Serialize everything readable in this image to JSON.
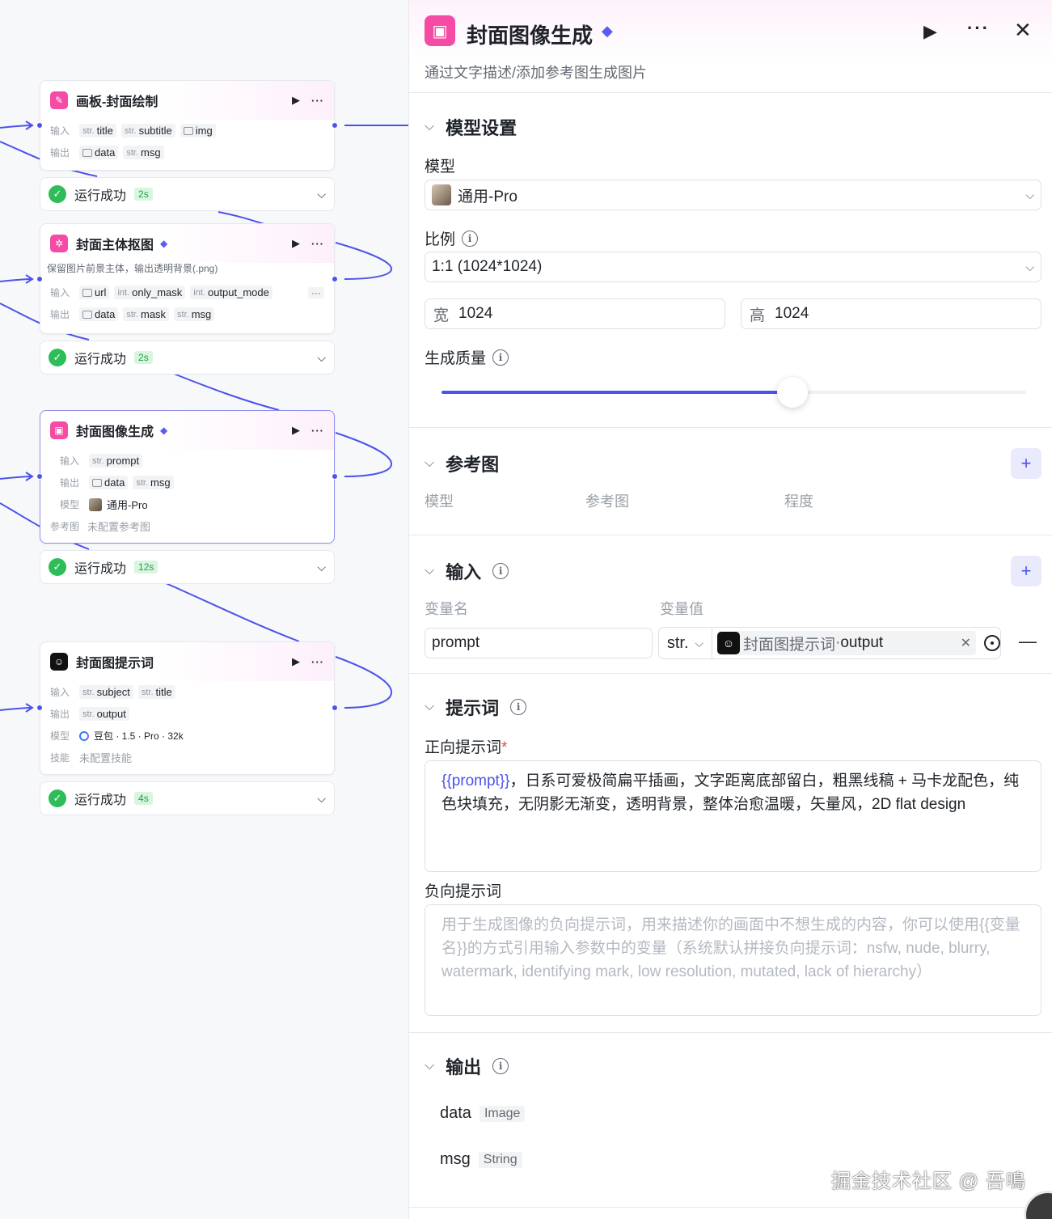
{
  "canvas": {
    "nodes": [
      {
        "id": "n1",
        "title": "画板-封面绘制",
        "has_premium": false,
        "icon": "pink-image-edit-icon",
        "inputs_label": "输入",
        "outputs_label": "输出",
        "inputs": [
          {
            "type": "str",
            "name": "title"
          },
          {
            "type": "str",
            "name": "subtitle"
          },
          {
            "type": "img",
            "name": "img"
          }
        ],
        "outputs": [
          {
            "type": "img",
            "name": "data"
          },
          {
            "type": "str",
            "name": "msg"
          }
        ],
        "status": "运行成功",
        "time": "2s"
      },
      {
        "id": "n2",
        "title": "封面主体抠图",
        "has_premium": true,
        "icon": "pink-cutout-icon",
        "description": "保留图片前景主体，输出透明背景(.png)",
        "inputs_label": "输入",
        "outputs_label": "输出",
        "inputs": [
          {
            "type": "img",
            "name": "url"
          },
          {
            "type": "int",
            "name": "only_mask"
          },
          {
            "type": "int",
            "name": "output_mode"
          }
        ],
        "inputs_more": "···",
        "outputs": [
          {
            "type": "img",
            "name": "data"
          },
          {
            "type": "str",
            "name": "mask"
          },
          {
            "type": "str",
            "name": "msg"
          }
        ],
        "status": "运行成功",
        "time": "2s"
      },
      {
        "id": "n3",
        "title": "封面图像生成",
        "has_premium": true,
        "icon": "pink-image-gen-icon",
        "inputs_label": "输入",
        "outputs_label": "输出",
        "model_label": "模型",
        "model_value": "通用-Pro",
        "ref_label": "参考图",
        "ref_value": "未配置参考图",
        "inputs": [
          {
            "type": "str",
            "name": "prompt"
          }
        ],
        "outputs": [
          {
            "type": "img",
            "name": "data"
          },
          {
            "type": "str",
            "name": "msg"
          }
        ],
        "status": "运行成功",
        "time": "12s"
      },
      {
        "id": "n4",
        "title": "封面图提示词",
        "has_premium": false,
        "icon": "black-llm-icon",
        "inputs_label": "输入",
        "outputs_label": "输出",
        "model_label": "模型",
        "model_value": "豆包 · 1.5 · Pro · 32k",
        "skill_label": "技能",
        "skill_value": "未配置技能",
        "inputs": [
          {
            "type": "str",
            "name": "subject"
          },
          {
            "type": "str",
            "name": "title"
          }
        ],
        "outputs": [
          {
            "type": "str",
            "name": "output"
          }
        ],
        "status": "运行成功",
        "time": "4s"
      }
    ]
  },
  "panel": {
    "title": "封面图像生成",
    "subtitle": "通过文字描述/添加参考图生成图片",
    "model_section": {
      "title": "模型设置",
      "model_label": "模型",
      "model_value": "通用-Pro",
      "ratio_label": "比例",
      "ratio_value": "1:1 (1024*1024)",
      "width_label": "宽",
      "width_value": "1024",
      "height_label": "高",
      "height_value": "1024",
      "quality_label": "生成质量",
      "quality_fraction": 0.6
    },
    "ref_section": {
      "title": "参考图",
      "col_model": "模型",
      "col_ref": "参考图",
      "col_degree": "程度"
    },
    "input_section": {
      "title": "输入",
      "col_name": "变量名",
      "col_value": "变量值",
      "var_name": "prompt",
      "var_type": "str.",
      "ref_source": "封面图提示词",
      "ref_sep": " · ",
      "ref_field": "output"
    },
    "prompt_section": {
      "title": "提示词",
      "positive_label": "正向提示词",
      "required_mark": "*",
      "positive_var": "{{prompt}}",
      "positive_text": "，日系可爱极简扁平插画，文字距离底部留白，粗黑线稿 + 马卡龙配色，纯色块填充，无阴影无渐变，透明背景，整体治愈温暖，矢量风，2D flat design",
      "negative_label": "负向提示词",
      "negative_placeholder": "用于生成图像的负向提示词，用来描述你的画面中不想生成的内容，你可以使用{{变量名}}的方式引用输入参数中的变量（系统默认拼接负向提示词：nsfw, nude, blurry, watermark, identifying mark, low resolution, mutated, lack of hierarchy）"
    },
    "output_section": {
      "title": "输出",
      "outputs": [
        {
          "name": "data",
          "type": "Image"
        },
        {
          "name": "msg",
          "type": "String"
        }
      ]
    }
  },
  "watermark": "掘金技术社区 @ 吾鳴",
  "colors": {
    "accent": "#4d53e8",
    "brand_pink": "#f54ba5",
    "success": "#2ebd59",
    "success_bg": "#d8f5df",
    "required": "#e5484d"
  }
}
